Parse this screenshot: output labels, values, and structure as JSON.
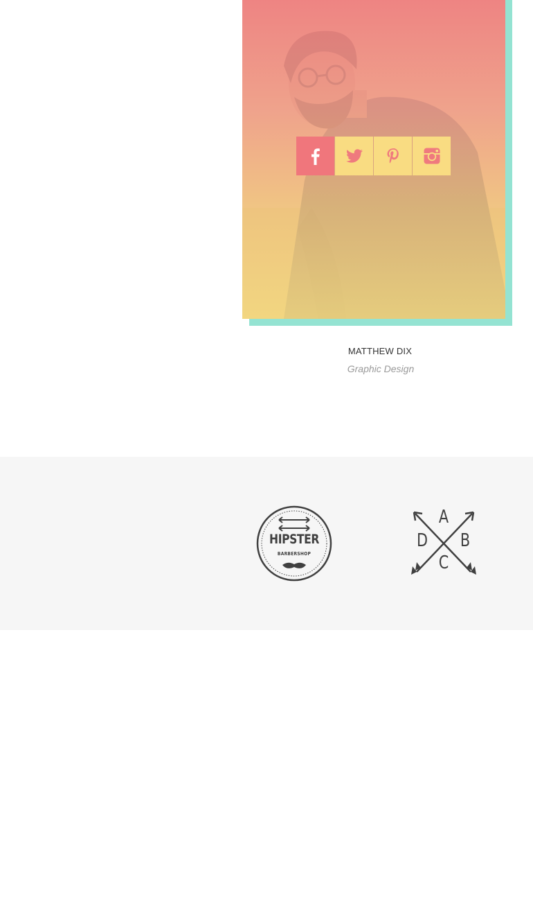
{
  "team_member": {
    "name": "MATTHEW DIX",
    "role": "Graphic Design",
    "photo_description_icon": "person-photo",
    "social": [
      {
        "name": "facebook",
        "icon": "facebook-icon"
      },
      {
        "name": "twitter",
        "icon": "twitter-icon"
      },
      {
        "name": "pinterest",
        "icon": "pinterest-icon"
      },
      {
        "name": "instagram",
        "icon": "instagram-icon"
      }
    ]
  },
  "clients": {
    "logos": [
      {
        "word": "HIPSTER",
        "sub": "BARBERSHOP"
      },
      {
        "letters": [
          "A",
          "B",
          "C",
          "D"
        ]
      }
    ]
  },
  "colors": {
    "accent_shadow": "#94e3d2",
    "overlay_top": "#f08082",
    "overlay_bottom": "#f6da82",
    "social_active": "#f0767c",
    "social_default": "#f9dc82",
    "strip_bg": "#f6f6f6",
    "logo_color": "#404040"
  }
}
